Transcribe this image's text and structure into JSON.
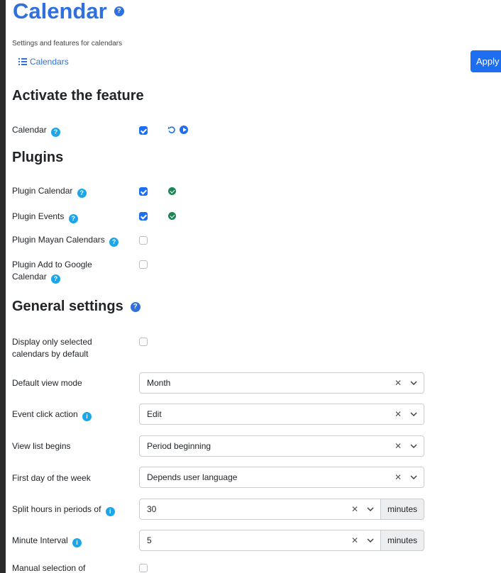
{
  "header": {
    "title": "Calendar",
    "subtitle": "Settings and features for calendars",
    "calendars_link": "Calendars",
    "apply_label": "Apply"
  },
  "sections": {
    "activate": "Activate the feature",
    "plugins": "Plugins",
    "general": "General settings"
  },
  "feature": {
    "calendar_label": "Calendar",
    "calendar_checked": true
  },
  "plugins": [
    {
      "label": "Plugin Calendar",
      "checked": true,
      "status": "enabled"
    },
    {
      "label": "Plugin Events",
      "checked": true,
      "status": "enabled"
    },
    {
      "label": "Plugin Mayan Calendars",
      "checked": false
    },
    {
      "label": "Plugin Add to Google Calendar",
      "checked": false
    }
  ],
  "general": {
    "display_selected_label": "Display only selected calendars by default",
    "default_view_label": "Default view mode",
    "default_view_value": "Month",
    "click_action_label": "Event click action",
    "click_action_value": "Edit",
    "view_list_label": "View list begins",
    "view_list_value": "Period beginning",
    "first_day_label": "First day of the week",
    "first_day_value": "Depends user language",
    "split_hours_label": "Split hours in periods of",
    "split_hours_value": "30",
    "split_hours_unit": "minutes",
    "minute_interval_label": "Minute Interval",
    "minute_interval_value": "5",
    "minute_interval_unit": "minutes",
    "manual_selection_label": "Manual selection of"
  },
  "icons": {
    "help": "question-circle-icon",
    "info": "info-circle-icon",
    "reset": "undo-icon",
    "preview": "play-circle-icon",
    "ok": "check-circle-icon",
    "list": "list-icon"
  },
  "colors": {
    "accent": "#2f6fde",
    "button": "#1d6ef0",
    "help": "#1aa6e8",
    "ok": "#198754"
  }
}
